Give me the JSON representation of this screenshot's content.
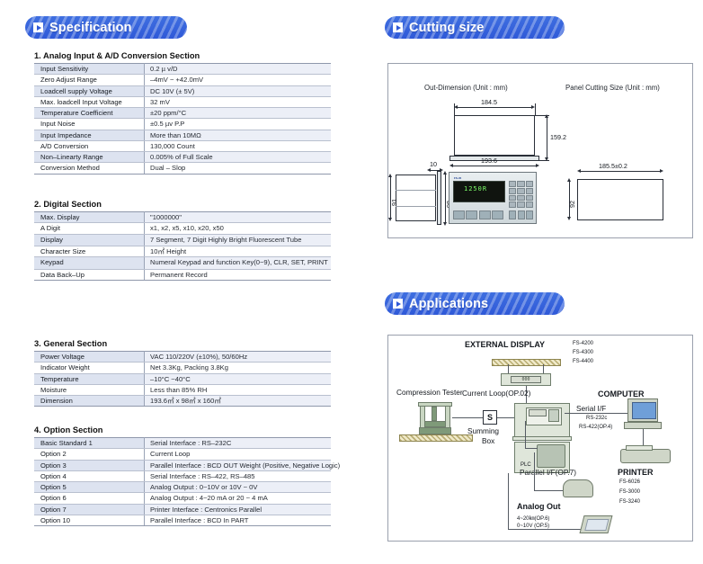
{
  "sections": {
    "specification": {
      "title": "Specification",
      "icon": "play-triangle-icon"
    },
    "cutting_size": {
      "title": "Cutting size",
      "icon": "play-triangle-icon"
    },
    "applications": {
      "title": "Applications",
      "icon": "play-triangle-icon"
    }
  },
  "spec_tables": [
    {
      "heading": "1. Analog Input & A/D Conversion Section",
      "rows": [
        {
          "key": "Input Sensitivity",
          "value": "0.2 µ v/D"
        },
        {
          "key": "Zero Adjust Range",
          "value": "–4mV ~ +42.0mV"
        },
        {
          "key": "Loadcell supply Voltage",
          "value": "DC 10V (± 5V)"
        },
        {
          "key": "Max. loadcell Input Voltage",
          "value": "32 mV"
        },
        {
          "key": "Temperature Coefficient",
          "value": "±20 ppm/°C"
        },
        {
          "key": "Input Noise",
          "value": "±0.5 µv P.P"
        },
        {
          "key": "Input Impedance",
          "value": "More than 10MΩ"
        },
        {
          "key": "A/D Conversion",
          "value": "130,000 Count"
        },
        {
          "key": "Non–Linearty Range",
          "value": "0.005% of Full Scale"
        },
        {
          "key": "Conversion Method",
          "value": "Dual – Slop"
        }
      ]
    },
    {
      "heading": "2. Digital Section",
      "rows": [
        {
          "key": "Max. Display",
          "value": "\"1000000\""
        },
        {
          "key": "A Digit",
          "value": "x1, x2, x5, x10, x20, x50"
        },
        {
          "key": "Display",
          "value": "7 Segment, 7 Digit Highly Bright Fluorescent Tube",
          "wrap": true
        },
        {
          "key": "Character Size",
          "value": "10㎡ Height"
        },
        {
          "key": "Keypad",
          "value": "Numeral Keypad and function Key(0~9), CLR, SET, PRINT",
          "wrap": true
        },
        {
          "key": "Data Back–Up",
          "value": "Permanent Record"
        }
      ]
    },
    {
      "heading": "3. General Section",
      "rows": [
        {
          "key": "Power Voltage",
          "value": "VAC 110/220V (±10%), 50/60Hz"
        },
        {
          "key": "Indicator Weight",
          "value": "Net 3.3Kg, Packing 3.8Kg"
        },
        {
          "key": "Temperature",
          "value": "–10°C ~40°C"
        },
        {
          "key": "Moisture",
          "value": "Less than 85% RH"
        },
        {
          "key": "Dimension",
          "value": "193.6㎡ x 98㎡ x 160㎡"
        }
      ]
    },
    {
      "heading": "4. Option Section",
      "rows": [
        {
          "key": "Basic Standard 1",
          "value": "Serial Interface : RS–232C"
        },
        {
          "key": "Option 2",
          "value": "Current Loop"
        },
        {
          "key": "Option 3",
          "value": "Parallel Interface : BCD OUT Weight (Positive, Negative Logic)"
        },
        {
          "key": "Option 4",
          "value": "Serial Interface : RS–422, RS–485"
        },
        {
          "key": "Option 5",
          "value": "Analog Output : 0~10V or 10V ~ 0V"
        },
        {
          "key": "Option 6",
          "value": "Analog Output : 4~20 mA or 20 ~ 4 mA"
        },
        {
          "key": "Option 7",
          "value": "Printer Interface : Centronics Parallel"
        },
        {
          "key": "Option 10",
          "value": "Parallel Interface : BCD In PART"
        }
      ]
    }
  ],
  "cutting": {
    "out_dimension_label": "Out-Dimension (Unit : mm)",
    "panel_cut_label": "Panel Cutting Size (Unit : mm)",
    "dims": {
      "width_top": "184.5",
      "height_right": "159.2",
      "width_front": "193.6",
      "depth": "10",
      "side_height": "91",
      "front_height": "98",
      "cut_width": "185.5±0.2",
      "cut_height": "92"
    },
    "display_value": "1250R"
  },
  "applications": {
    "external_display": {
      "title": "EXTERNAL  DISPLAY",
      "models": [
        "FS-4200",
        "FS-4300",
        "FS-4400"
      ],
      "readout": "000"
    },
    "compression_tester": "Compression Tester",
    "summing_box": {
      "letter": "S",
      "label_line1": "Summing",
      "label_line2": "Box"
    },
    "current_loop": "Current Loop(OP.02)",
    "computer": {
      "title": "COMPUTER",
      "interface": "Serial I/F",
      "specs": [
        "RS-232c",
        "RS-422(OP.4)"
      ]
    },
    "parallel_if": "Parallel I/F(OP.7)",
    "plc_label": "PLC",
    "printer": {
      "title": "PRINTER",
      "models": [
        "FS-6026",
        "FS-3000",
        "FS-3240"
      ]
    },
    "analog_out": {
      "title": "Analog Out",
      "specs": [
        "4~20㎞(OP.6)",
        "0~10V (OP.5)"
      ]
    }
  },
  "colors": {
    "badge_blue": "#2f59d8",
    "table_row_alt": "#dde3f0",
    "table_border": "#b9c0cf",
    "display_green": "#7dff6a"
  }
}
